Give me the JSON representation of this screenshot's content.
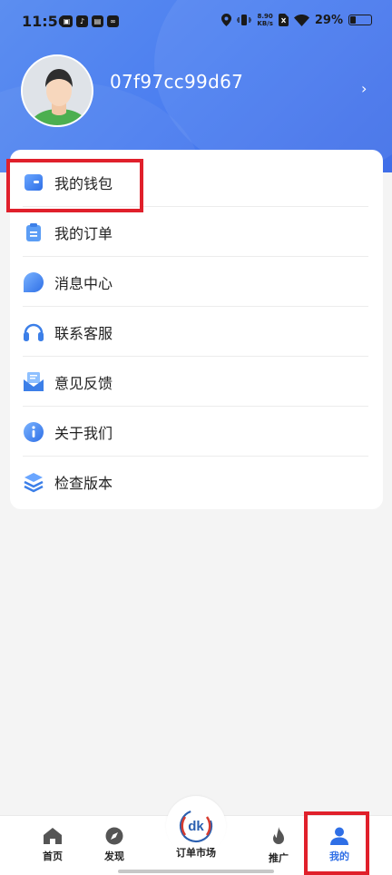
{
  "status_bar": {
    "time": "11:56",
    "net_speed_value": "8.90",
    "net_speed_unit": "KB/s",
    "battery_pct": "29%",
    "battery_level": 0.29
  },
  "profile": {
    "username": "07f97cc99d67",
    "chevron": "›"
  },
  "menu": {
    "items": [
      {
        "label": "我的钱包",
        "icon": "wallet-icon"
      },
      {
        "label": "我的订单",
        "icon": "clipboard-icon"
      },
      {
        "label": "消息中心",
        "icon": "chat-bubble-icon"
      },
      {
        "label": "联系客服",
        "icon": "headset-icon"
      },
      {
        "label": "意见反馈",
        "icon": "mail-icon"
      },
      {
        "label": "关于我们",
        "icon": "info-icon"
      },
      {
        "label": "检查版本",
        "icon": "layers-icon"
      }
    ]
  },
  "bottom_nav": {
    "home": "首页",
    "discover": "发现",
    "center": "订单市场",
    "center_logo_text": "dk",
    "promote": "推广",
    "mine": "我的"
  },
  "colors": {
    "accent": "#2f6fe6",
    "header": "#4b7ef0",
    "highlight": "#e0202b"
  }
}
